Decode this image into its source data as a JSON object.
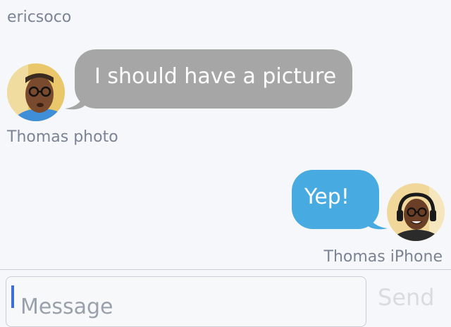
{
  "messages": [
    {
      "sender": "ericsoco"
    },
    {
      "sender": "Thomas photo",
      "text": "I should have a picture",
      "direction": "incoming",
      "bubble_color": "#a6a6a6",
      "avatar": "thomas-photo-avatar"
    },
    {
      "sender": "Thomas iPhone",
      "text": "Yep!",
      "direction": "outgoing",
      "bubble_color": "#47aae0",
      "avatar": "thomas-iphone-avatar"
    }
  ],
  "composer": {
    "placeholder": "Message",
    "send_label": "Send",
    "caret_color": "#3d6fd6"
  },
  "colors": {
    "background": "#f5f7fa",
    "sender_text": "#7b8394"
  }
}
